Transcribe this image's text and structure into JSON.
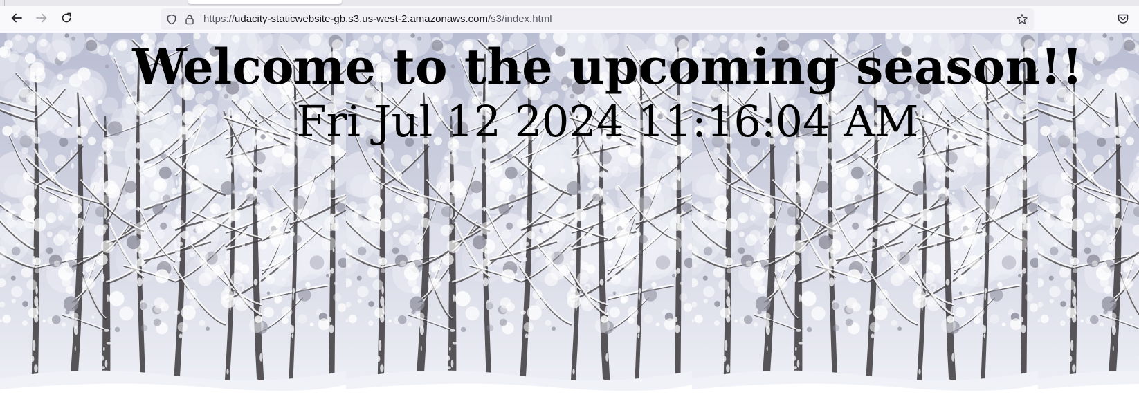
{
  "browser": {
    "url_prefix": "https://",
    "url_host": "udacity-staticwebsite-gb.s3.us-west-2.amazonaws.com",
    "url_path": "/s3/index.html",
    "icons": {
      "back": "arrow-left",
      "forward": "arrow-right",
      "reload": "circular-arrow",
      "tracking": "shield",
      "lock": "padlock",
      "bookmark": "star",
      "pocket": "pocket"
    }
  },
  "page": {
    "heading": "Welcome to the upcoming season!!",
    "datetime": "Fri Jul 12 2024 11:16:04 AM",
    "background": "repeated snowy forest photograph",
    "colors": {
      "sky": "#b9bdd2",
      "snow": "#f1f2f8",
      "trunk": "#3d3a3d",
      "text": "#000000"
    }
  }
}
